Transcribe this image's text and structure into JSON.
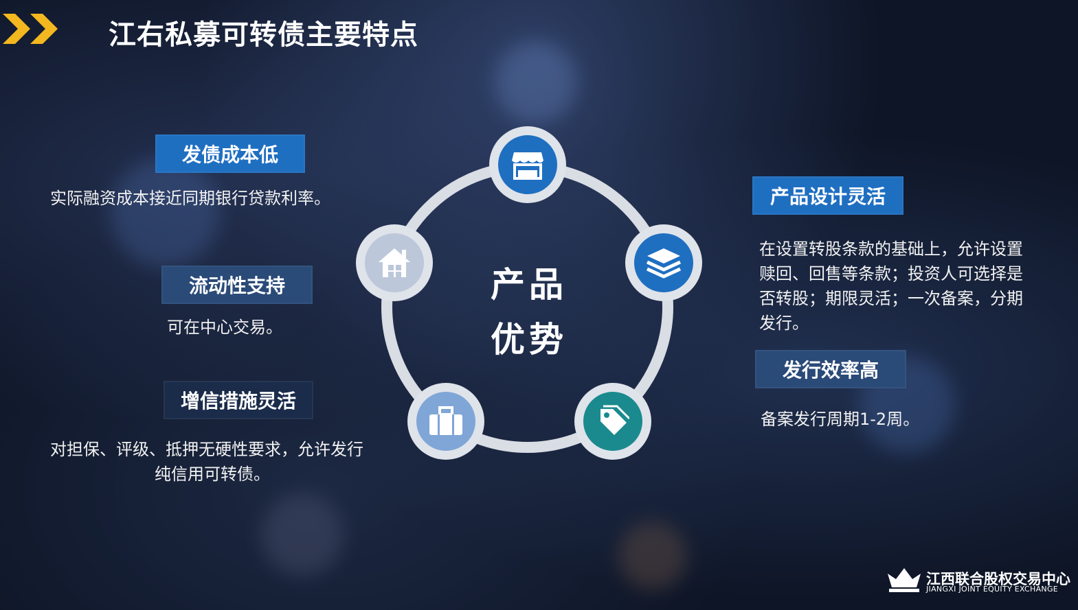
{
  "title": "江右私募可转债主要特点",
  "center": {
    "line1": "产品",
    "line2": "优势"
  },
  "features": {
    "cost": {
      "label": "发债成本低",
      "desc": "实际融资成本接近同期银行贷款利率。"
    },
    "liquid": {
      "label": "流动性支持",
      "desc": "可在中心交易。"
    },
    "credit": {
      "label": "增信措施灵活",
      "desc_line1": "对担保、评级、抵押无硬性要求，允许发行",
      "desc_line2": "纯信用可转债。"
    },
    "design": {
      "label": "产品设计灵活",
      "desc_line1": "在设置转股条款的基础上，允许设置",
      "desc_line2": "赎回、回售等条款；投资人可选择是",
      "desc_line3": "否转股；期限灵活；一次备案，分期",
      "desc_line4": "发行。"
    },
    "speed": {
      "label": "发行效率高",
      "desc": "备案发行周期1-2周。"
    }
  },
  "icons": {
    "top": "store-icon",
    "right": "layers-icon",
    "bottom_right": "tag-icon",
    "bottom_left": "briefcase-icon",
    "left": "house-icon"
  },
  "colors": {
    "label_blue": "#1f6fc1",
    "label_dark": "#2a4a78",
    "accent_yellow": "#f3b81f",
    "node_blue": "#1f6fc1",
    "node_teal": "#1a8a8e",
    "node_light": "#7fa6d6",
    "node_pale": "#bcc8da"
  },
  "logo": {
    "cn": "江西联合股权交易中心",
    "en": "JIANGXI JOINT EQUITY EXCHANGE"
  }
}
